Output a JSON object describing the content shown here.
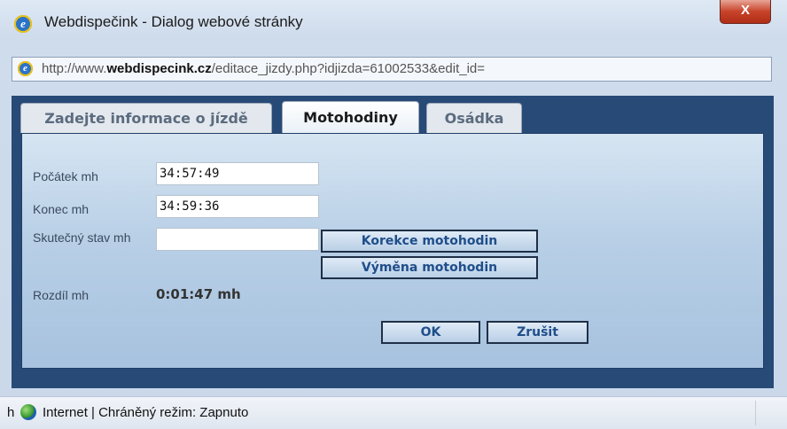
{
  "window": {
    "title": "Webdispečink - Dialog webové stránky",
    "close_label": "X"
  },
  "address": {
    "prefix": "http://www.",
    "domain": "webdispecink.cz",
    "path": "/editace_jizdy.php?idjizda=61002533&edit_id="
  },
  "tabs": [
    {
      "label": "Zadejte informace o jízdě",
      "active": false
    },
    {
      "label": "Motohodiny",
      "active": true
    },
    {
      "label": "Osádka",
      "active": false
    }
  ],
  "form": {
    "start_label": "Počátek mh",
    "start_value": "34:57:49",
    "end_label": "Konec mh",
    "end_value": "34:59:36",
    "actual_label": "Skutečný stav mh",
    "actual_value": "",
    "correction_button": "Korekce motohodin",
    "exchange_button": "Výměna motohodin",
    "diff_label": "Rozdíl mh",
    "diff_value": "0:01:47 mh",
    "ok_button": "OK",
    "cancel_button": "Zrušit"
  },
  "status": {
    "prefix": "h",
    "text": "Internet | Chráněný režim: Zapnuto"
  },
  "colors": {
    "frame": "#274a77",
    "panel": "#b8cfe6",
    "button_text": "#1f4e8a"
  }
}
